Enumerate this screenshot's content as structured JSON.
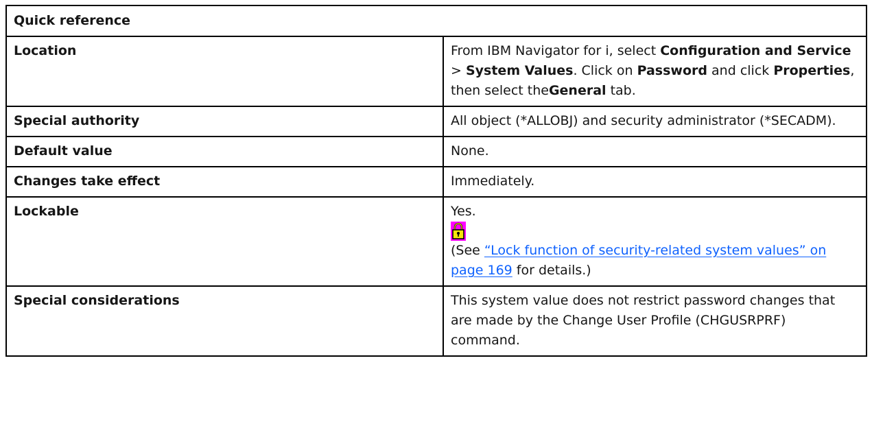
{
  "header": {
    "title": "Quick reference"
  },
  "rows": [
    {
      "label": "Location",
      "value": {
        "p1": "From IBM Navigator for i, select ",
        "b1": "Configuration and Service",
        "p2": " > ",
        "b2": "System Values",
        "p3": ". Click on ",
        "b3": "Password",
        "p4": " and click ",
        "b4": "Properties",
        "p5": ", then select the",
        "b5": "General",
        "p6": " tab."
      }
    },
    {
      "label": "Special authority",
      "value": "All object (*ALLOBJ) and security administrator (*SECADM)."
    },
    {
      "label": "Default value",
      "value": "None."
    },
    {
      "label": "Changes take effect",
      "value": "Immediately."
    },
    {
      "label": "Lockable",
      "value": {
        "yes": "Yes.",
        "icon": "padlock-icon",
        "see_prefix": "(See ",
        "link": "“Lock function of security-related system values” on page 169",
        "see_suffix": " for details.)"
      }
    },
    {
      "label": "Special considerations",
      "value": "This system value does not restrict password changes that are made by the Change User Profile (CHGUSRPRF) command."
    }
  ],
  "colors": {
    "link": "#0f62fe",
    "icon_background": "#ff00ff",
    "icon_lock": "#f5e60a"
  }
}
